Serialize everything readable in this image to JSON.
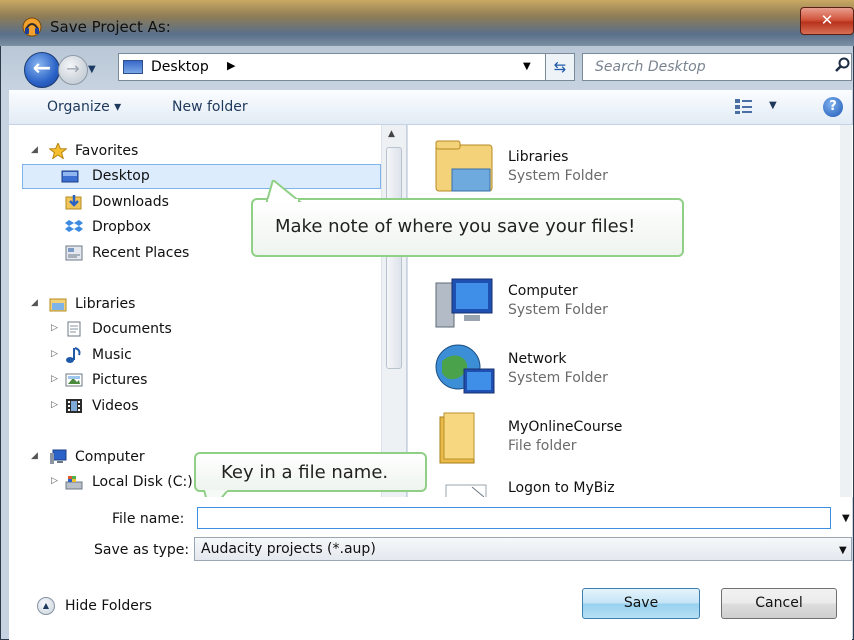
{
  "window": {
    "title": "Save Project As:",
    "close_glyph": "✕"
  },
  "address": {
    "location": "Desktop",
    "search_placeholder": "Search Desktop"
  },
  "toolbar": {
    "organize": "Organize ▾",
    "new_folder": "New folder",
    "help": "?"
  },
  "nav": {
    "favorites": {
      "label": "Favorites",
      "items": [
        "Desktop",
        "Downloads",
        "Dropbox",
        "Recent Places"
      ]
    },
    "libraries": {
      "label": "Libraries",
      "items": [
        "Documents",
        "Music",
        "Pictures",
        "Videos"
      ]
    },
    "computer": {
      "label": "Computer",
      "items": [
        "Local Disk (C:)"
      ]
    }
  },
  "content": {
    "items": [
      {
        "name": "Libraries",
        "type": "System Folder"
      },
      {
        "name": "Computer",
        "type": "System Folder"
      },
      {
        "name": "Network",
        "type": "System Folder"
      },
      {
        "name": "MyOnlineCourse",
        "type": "File folder"
      },
      {
        "name": "Logon to MyBiz",
        "type": ""
      }
    ]
  },
  "bottom": {
    "file_name_label": "File name:",
    "file_name_value": "",
    "save_type_label": "Save as type:",
    "save_type_value": "Audacity projects (*.aup)",
    "hide_folders": "Hide Folders",
    "save": "Save",
    "cancel": "Cancel"
  },
  "callouts": {
    "save_location": "Make note of where you save your files!",
    "file_name": "Key in a file name."
  },
  "colors": {
    "selection": "#dcecfc",
    "callout_border": "#8fcf86",
    "accent_blue": "#2a62c7"
  }
}
